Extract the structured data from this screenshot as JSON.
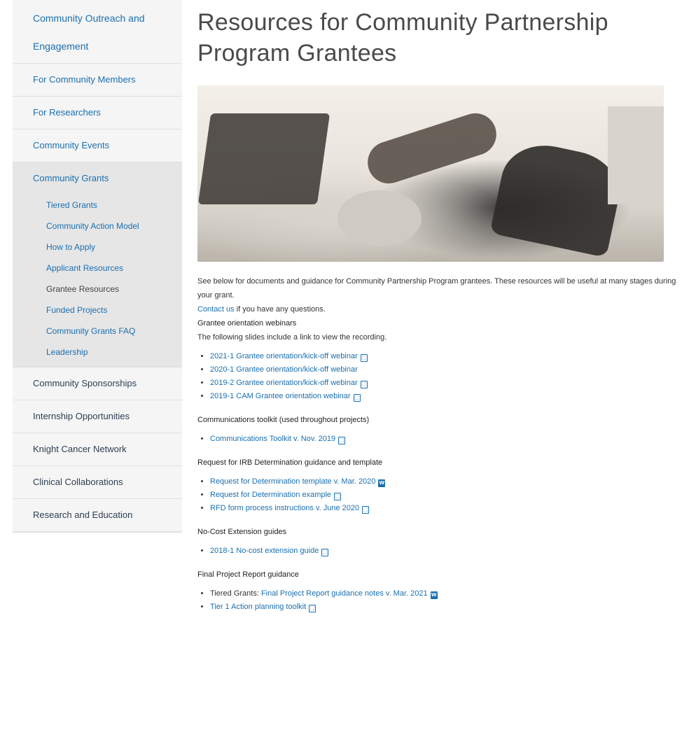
{
  "sidebar": {
    "top": "Community Outreach and Engagement",
    "items_before": [
      {
        "label": "For Community Members"
      },
      {
        "label": "For Researchers"
      },
      {
        "label": "Community Events"
      }
    ],
    "group_label": "Community Grants",
    "sub_items": [
      {
        "label": "Tiered Grants",
        "current": false
      },
      {
        "label": "Community Action Model",
        "current": false
      },
      {
        "label": "How to Apply",
        "current": false
      },
      {
        "label": "Applicant Resources",
        "current": false
      },
      {
        "label": "Grantee Resources",
        "current": true
      },
      {
        "label": "Funded Projects",
        "current": false
      },
      {
        "label": "Community Grants FAQ",
        "current": false
      },
      {
        "label": "Leadership",
        "current": false
      }
    ],
    "items_after": [
      {
        "label": "Community Sponsorships"
      },
      {
        "label": "Internship Opportunities"
      },
      {
        "label": "Knight Cancer Network"
      },
      {
        "label": "Clinical Collaborations"
      },
      {
        "label": "Research and Education"
      }
    ]
  },
  "main": {
    "title": "Resources for Community Partnership Program Grantees",
    "intro": "See below for documents and guidance for Community Partnership Program grantees. These resources will be useful at many stages during your grant.",
    "contact_link": "Contact us",
    "contact_rest": " if you have any questions.",
    "webinars": {
      "title": "Grantee orientation webinars",
      "desc": "The following slides include a link to view the recording.",
      "links": [
        "2021-1 Grantee orientation/kick-off webinar",
        "2020-1 Grantee orientation/kick-off webinar",
        "2019-2 Grantee orientation/kick-off webinar",
        "2019-1 CAM Grantee orientation webinar"
      ]
    },
    "comms": {
      "title": "Communications toolkit (used throughout projects)",
      "links": [
        "Communications Toolkit v. Nov. 2019"
      ]
    },
    "irb": {
      "title": "Request for IRB Determination guidance and template",
      "links": [
        "Request for Determination template v. Mar. 2020",
        "Request for Determination example",
        "RFD form process instructions v. June 2020"
      ]
    },
    "nce": {
      "title": "No-Cost Extension guides",
      "links": [
        "2018-1 No-cost extension guide"
      ]
    },
    "final": {
      "title": "Final Project Report guidance",
      "prefix": "Tiered Grants: ",
      "link": "Final Project Report guidance notes v. Mar. 2021",
      "next": "Tier 1 Action planning toolkit"
    }
  },
  "icons": {
    "pdf": "pdf-file-icon",
    "word": "word-file-icon"
  }
}
